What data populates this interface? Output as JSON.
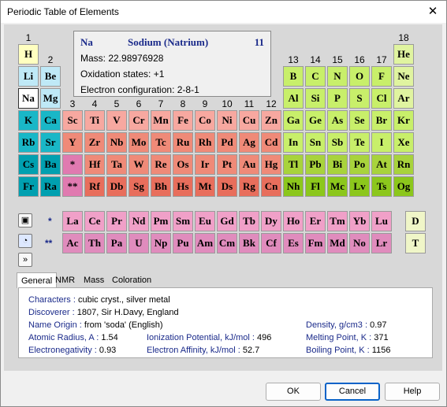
{
  "window": {
    "title": "Periodic Table of Elements"
  },
  "info": {
    "symbol": "Na",
    "name": "Sodium (Natrium)",
    "number": "11",
    "mass": "Mass: 22.98976928",
    "oxidation": "Oxidation states: +1",
    "config": "Electron configuration: 2-8-1"
  },
  "table": {
    "group_numbers": [
      "1",
      "2",
      "3",
      "4",
      "5",
      "6",
      "7",
      "8",
      "9",
      "10",
      "11",
      "12",
      "13",
      "14",
      "15",
      "16",
      "17",
      "18"
    ],
    "rows": {
      "r1": [
        "H",
        "He"
      ],
      "r2": [
        "Li",
        "Be",
        "B",
        "C",
        "N",
        "O",
        "F",
        "Ne"
      ],
      "r3": [
        "Na",
        "Mg",
        "Al",
        "Si",
        "P",
        "S",
        "Cl",
        "Ar"
      ],
      "r4": [
        "K",
        "Ca",
        "Sc",
        "Ti",
        "V",
        "Cr",
        "Mn",
        "Fe",
        "Co",
        "Ni",
        "Cu",
        "Zn",
        "Ga",
        "Ge",
        "As",
        "Se",
        "Br",
        "Kr"
      ],
      "r5": [
        "Rb",
        "Sr",
        "Y",
        "Zr",
        "Nb",
        "Mo",
        "Tc",
        "Ru",
        "Rh",
        "Pd",
        "Ag",
        "Cd",
        "In",
        "Sn",
        "Sb",
        "Te",
        "I",
        "Xe"
      ],
      "r6": [
        "Cs",
        "Ba",
        "*",
        "Hf",
        "Ta",
        "W",
        "Re",
        "Os",
        "Ir",
        "Pt",
        "Au",
        "Hg",
        "Tl",
        "Pb",
        "Bi",
        "Po",
        "At",
        "Rn"
      ],
      "r7": [
        "Fr",
        "Ra",
        "**",
        "Rf",
        "Db",
        "Sg",
        "Bh",
        "Hs",
        "Mt",
        "Ds",
        "Rg",
        "Cn",
        "Nh",
        "Fl",
        "Mc",
        "Lv",
        "Ts",
        "Og"
      ]
    },
    "lanthanides": [
      "La",
      "Ce",
      "Pr",
      "Nd",
      "Pm",
      "Sm",
      "Eu",
      "Gd",
      "Tb",
      "Dy",
      "Ho",
      "Er",
      "Tm",
      "Yb",
      "Lu"
    ],
    "actinides": [
      "Ac",
      "Th",
      "Pa",
      "U",
      "Np",
      "Pu",
      "Am",
      "Cm",
      "Bk",
      "Cf",
      "Es",
      "Fm",
      "Md",
      "No",
      "Lr"
    ],
    "series_labels": {
      "lan": "*",
      "act": "**"
    },
    "side": [
      "D",
      "T"
    ]
  },
  "tabs": [
    "General",
    "NMR",
    "Mass",
    "Coloration"
  ],
  "details": {
    "characters_label": "Characters :",
    "characters": "cubic cryst., silver metal",
    "discoverer_label": "Discoverer :",
    "discoverer": "1807, Sir H.Davy, England",
    "origin_label": "Name Origin :",
    "origin": "from 'soda' (English)",
    "radius_label": "Atomic Radius, A :",
    "radius": "1.54",
    "ionization_label": "Ionization Potential, kJ/mol :",
    "ionization": "496",
    "electroneg_label": "Electronegativity :",
    "electroneg": "0.93",
    "affinity_label": "Electron Affinity, kJ/mol :",
    "affinity": "52.7",
    "density_label": "Density, g/cm3 :",
    "density": "0.97",
    "melting_label": "Melting Point, K :",
    "melting": "371",
    "boiling_label": "Boiling Point, K :",
    "boiling": "1156"
  },
  "buttons": {
    "ok": "OK",
    "cancel": "Cancel",
    "help": "Help"
  },
  "icons": {
    "close": "close-icon",
    "camera": "camera-icon",
    "pie": "pie-chart-icon",
    "expand": "chevron-double-down-icon"
  }
}
